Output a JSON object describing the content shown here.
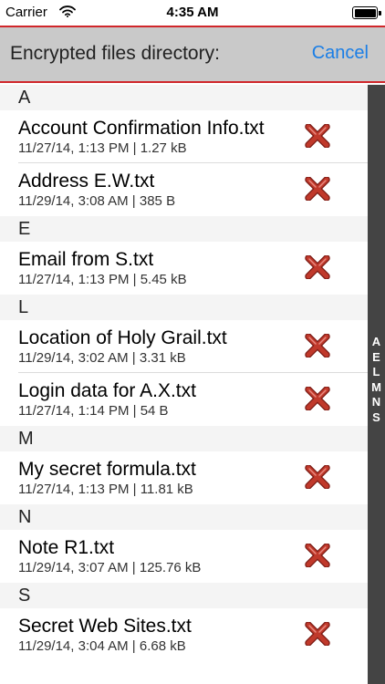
{
  "status_bar": {
    "carrier": "Carrier",
    "time": "4:35 AM"
  },
  "nav": {
    "title": "Encrypted files directory:",
    "cancel_label": "Cancel"
  },
  "sections": [
    {
      "letter": "A",
      "files": [
        {
          "name": "Account Confirmation Info.txt",
          "meta": "11/27/14, 1:13 PM | 1.27 kB"
        },
        {
          "name": "Address E.W.txt",
          "meta": "11/29/14, 3:08 AM | 385 B"
        }
      ]
    },
    {
      "letter": "E",
      "files": [
        {
          "name": "Email from S.txt",
          "meta": "11/27/14, 1:13 PM | 5.45 kB"
        }
      ]
    },
    {
      "letter": "L",
      "files": [
        {
          "name": "Location of Holy Grail.txt",
          "meta": "11/29/14, 3:02 AM | 3.31 kB"
        },
        {
          "name": "Login data for A.X.txt",
          "meta": "11/27/14, 1:14 PM | 54 B"
        }
      ]
    },
    {
      "letter": "M",
      "files": [
        {
          "name": "My secret formula.txt",
          "meta": "11/27/14, 1:13 PM | 11.81 kB"
        }
      ]
    },
    {
      "letter": "N",
      "files": [
        {
          "name": "Note R1.txt",
          "meta": "11/29/14, 3:07 AM | 125.76 kB"
        }
      ]
    },
    {
      "letter": "S",
      "files": [
        {
          "name": "Secret Web Sites.txt",
          "meta": "11/29/14, 3:04 AM | 6.68 kB"
        }
      ]
    }
  ],
  "index": [
    "A",
    "E",
    "L",
    "M",
    "N",
    "S"
  ],
  "icons": {
    "delete": "delete-x-icon",
    "wifi": "wifi-icon",
    "battery": "battery-icon"
  },
  "colors": {
    "accent_red": "#d0262a",
    "link_blue": "#1a7ee6",
    "delete_red": "#c0392b",
    "index_bar": "#444444"
  }
}
